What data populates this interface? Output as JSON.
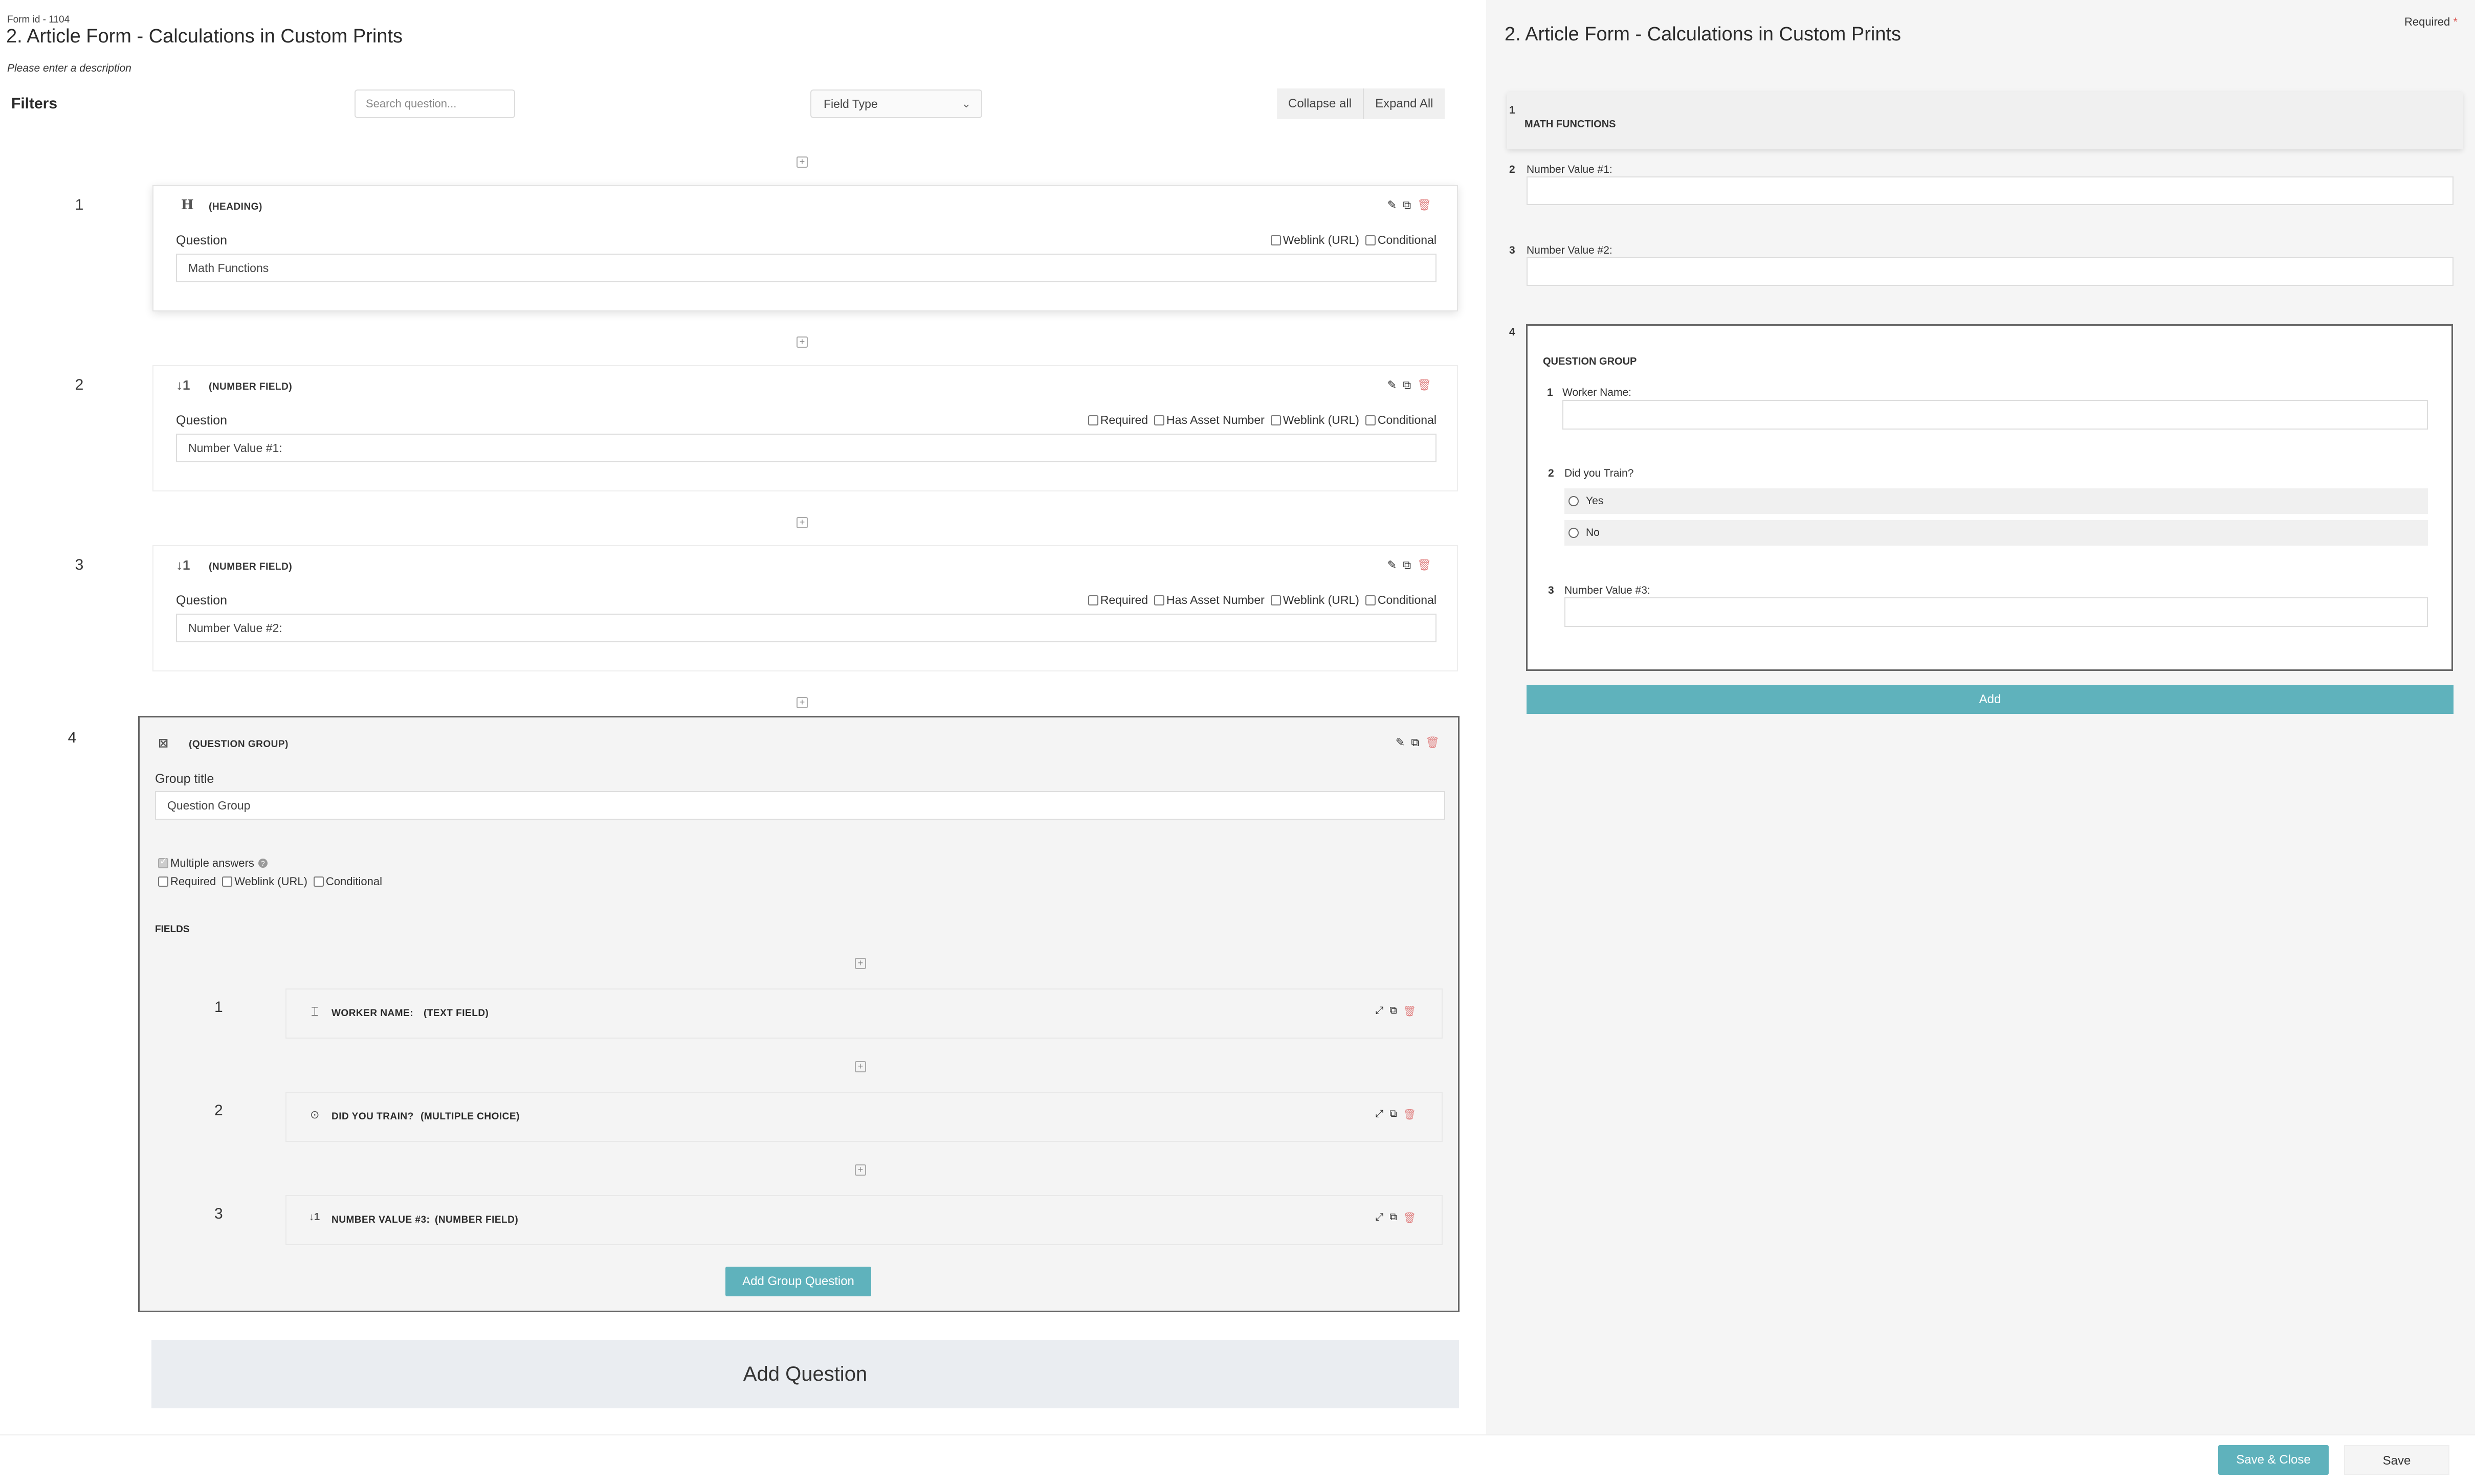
{
  "form": {
    "id_label": "Form id - 1104",
    "title": "2. Article Form - Calculations in Custom Prints",
    "description": "Please enter a description"
  },
  "filters": {
    "label": "Filters",
    "search_placeholder": "Search question...",
    "field_type": "Field Type",
    "collapse_all": "Collapse all",
    "expand_all": "Expand All"
  },
  "questions": [
    {
      "number": "1",
      "icon": "heading-icon",
      "type": "(HEADING)",
      "question_label": "Question",
      "value": "Math Functions",
      "options": [
        "Weblink (URL)",
        "Conditional"
      ]
    },
    {
      "number": "2",
      "icon": "number-field-icon",
      "type": "(NUMBER FIELD)",
      "question_label": "Question",
      "value": "Number Value #1:",
      "options": [
        "Required",
        "Has Asset Number",
        "Weblink (URL)",
        "Conditional"
      ]
    },
    {
      "number": "3",
      "icon": "number-field-icon",
      "type": "(NUMBER FIELD)",
      "question_label": "Question",
      "value": "Number Value #2:",
      "options": [
        "Required",
        "Has Asset Number",
        "Weblink (URL)",
        "Conditional"
      ]
    },
    {
      "number": "4",
      "icon": "question-group-icon",
      "type": "(QUESTION GROUP)",
      "group_title_label": "Group title",
      "value": "Question Group",
      "multiple_answers": "Multiple answers",
      "options": [
        "Required",
        "Weblink (URL)",
        "Conditional"
      ],
      "fields_label": "FIELDS",
      "fields": [
        {
          "number": "1",
          "icon": "text-field-icon",
          "name": "WORKER NAME:",
          "type": "(TEXT FIELD)"
        },
        {
          "number": "2",
          "icon": "multiple-choice-icon",
          "name": "DID YOU TRAIN?",
          "type": "(MULTIPLE CHOICE)"
        },
        {
          "number": "3",
          "icon": "number-field-icon",
          "name": "NUMBER VALUE #3:",
          "type": "(NUMBER FIELD)"
        }
      ],
      "add_group_question": "Add Group Question"
    }
  ],
  "add_question": "Add Question",
  "preview": {
    "title": "2. Article Form - Calculations in Custom Prints",
    "required_note": "Required",
    "required_star": "*",
    "items": [
      {
        "number": "1",
        "label": "MATH FUNCTIONS"
      },
      {
        "number": "2",
        "label": "Number Value #1:"
      },
      {
        "number": "3",
        "label": "Number Value #2:"
      },
      {
        "number": "4",
        "label": "QUESTION GROUP"
      }
    ],
    "group_items": [
      {
        "number": "1",
        "label": "Worker Name:"
      },
      {
        "number": "2",
        "label": "Did you Train?"
      },
      {
        "number": "3",
        "label": "Number Value #3:"
      }
    ],
    "radio_options": [
      "Yes",
      "No"
    ],
    "add_button": "Add"
  },
  "footer": {
    "save_close": "Save & Close",
    "save": "Save"
  },
  "colors": {
    "accent": "#5fb2bc",
    "delete": "#e08080",
    "required_star": "#d9534f"
  }
}
